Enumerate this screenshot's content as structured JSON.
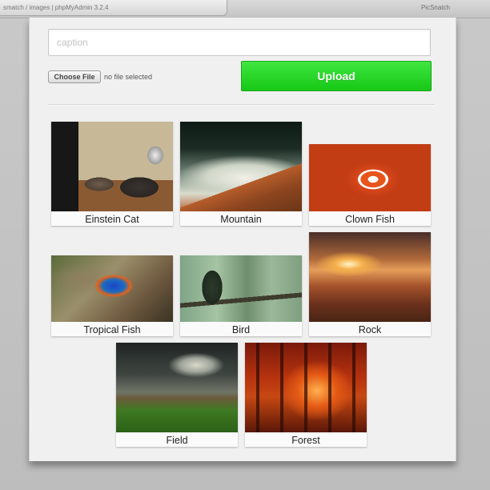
{
  "browser": {
    "tab_title": "smatch / images | phpMyAdmin 3.2.4",
    "right_label": "PicSnatch"
  },
  "form": {
    "caption_placeholder": "caption",
    "choose_file_label": "Choose File",
    "file_status": "no file selected",
    "upload_label": "Upload"
  },
  "colors": {
    "upload_green": "#22d622",
    "panel_bg": "#f0f0f0"
  },
  "gallery": [
    {
      "label": "Einstein Cat"
    },
    {
      "label": "Mountain"
    },
    {
      "label": "Clown Fish"
    },
    {
      "label": "Tropical Fish"
    },
    {
      "label": "Bird"
    },
    {
      "label": "Rock"
    },
    {
      "label": "Field"
    },
    {
      "label": "Forest"
    }
  ]
}
